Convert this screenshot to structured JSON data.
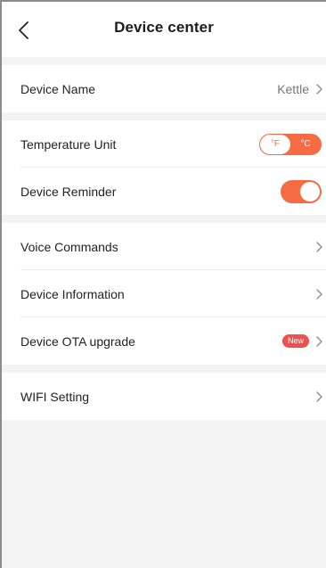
{
  "header": {
    "title": "Device center"
  },
  "rows": {
    "device_name": {
      "label": "Device Name",
      "value": "Kettle"
    },
    "temperature_unit": {
      "label": "Temperature Unit",
      "options": [
        "°F",
        "°C"
      ],
      "selected": "°C"
    },
    "device_reminder": {
      "label": "Device Reminder",
      "enabled": true
    },
    "voice_commands": {
      "label": "Voice Commands"
    },
    "device_information": {
      "label": "Device Information"
    },
    "ota_upgrade": {
      "label": "Device OTA upgrade",
      "badge": "New"
    },
    "wifi_setting": {
      "label": "WIFI Setting"
    }
  },
  "colors": {
    "accent": "#f56b43",
    "badge": "#ef4f4f",
    "background": "#f3f3f4"
  },
  "icons": {
    "back": "chevron-left-icon",
    "row_arrow": "chevron-right-icon"
  }
}
